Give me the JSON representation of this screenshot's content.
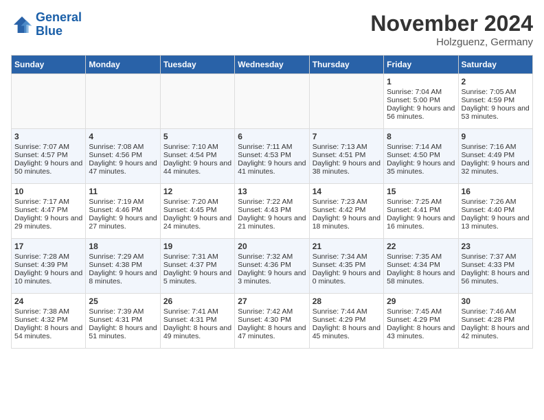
{
  "logo": {
    "line1": "General",
    "line2": "Blue"
  },
  "title": "November 2024",
  "location": "Holzguenz, Germany",
  "days_of_week": [
    "Sunday",
    "Monday",
    "Tuesday",
    "Wednesday",
    "Thursday",
    "Friday",
    "Saturday"
  ],
  "weeks": [
    [
      {
        "day": "",
        "content": ""
      },
      {
        "day": "",
        "content": ""
      },
      {
        "day": "",
        "content": ""
      },
      {
        "day": "",
        "content": ""
      },
      {
        "day": "",
        "content": ""
      },
      {
        "day": "1",
        "content": "Sunrise: 7:04 AM\nSunset: 5:00 PM\nDaylight: 9 hours and 56 minutes."
      },
      {
        "day": "2",
        "content": "Sunrise: 7:05 AM\nSunset: 4:59 PM\nDaylight: 9 hours and 53 minutes."
      }
    ],
    [
      {
        "day": "3",
        "content": "Sunrise: 7:07 AM\nSunset: 4:57 PM\nDaylight: 9 hours and 50 minutes."
      },
      {
        "day": "4",
        "content": "Sunrise: 7:08 AM\nSunset: 4:56 PM\nDaylight: 9 hours and 47 minutes."
      },
      {
        "day": "5",
        "content": "Sunrise: 7:10 AM\nSunset: 4:54 PM\nDaylight: 9 hours and 44 minutes."
      },
      {
        "day": "6",
        "content": "Sunrise: 7:11 AM\nSunset: 4:53 PM\nDaylight: 9 hours and 41 minutes."
      },
      {
        "day": "7",
        "content": "Sunrise: 7:13 AM\nSunset: 4:51 PM\nDaylight: 9 hours and 38 minutes."
      },
      {
        "day": "8",
        "content": "Sunrise: 7:14 AM\nSunset: 4:50 PM\nDaylight: 9 hours and 35 minutes."
      },
      {
        "day": "9",
        "content": "Sunrise: 7:16 AM\nSunset: 4:49 PM\nDaylight: 9 hours and 32 minutes."
      }
    ],
    [
      {
        "day": "10",
        "content": "Sunrise: 7:17 AM\nSunset: 4:47 PM\nDaylight: 9 hours and 29 minutes."
      },
      {
        "day": "11",
        "content": "Sunrise: 7:19 AM\nSunset: 4:46 PM\nDaylight: 9 hours and 27 minutes."
      },
      {
        "day": "12",
        "content": "Sunrise: 7:20 AM\nSunset: 4:45 PM\nDaylight: 9 hours and 24 minutes."
      },
      {
        "day": "13",
        "content": "Sunrise: 7:22 AM\nSunset: 4:43 PM\nDaylight: 9 hours and 21 minutes."
      },
      {
        "day": "14",
        "content": "Sunrise: 7:23 AM\nSunset: 4:42 PM\nDaylight: 9 hours and 18 minutes."
      },
      {
        "day": "15",
        "content": "Sunrise: 7:25 AM\nSunset: 4:41 PM\nDaylight: 9 hours and 16 minutes."
      },
      {
        "day": "16",
        "content": "Sunrise: 7:26 AM\nSunset: 4:40 PM\nDaylight: 9 hours and 13 minutes."
      }
    ],
    [
      {
        "day": "17",
        "content": "Sunrise: 7:28 AM\nSunset: 4:39 PM\nDaylight: 9 hours and 10 minutes."
      },
      {
        "day": "18",
        "content": "Sunrise: 7:29 AM\nSunset: 4:38 PM\nDaylight: 9 hours and 8 minutes."
      },
      {
        "day": "19",
        "content": "Sunrise: 7:31 AM\nSunset: 4:37 PM\nDaylight: 9 hours and 5 minutes."
      },
      {
        "day": "20",
        "content": "Sunrise: 7:32 AM\nSunset: 4:36 PM\nDaylight: 9 hours and 3 minutes."
      },
      {
        "day": "21",
        "content": "Sunrise: 7:34 AM\nSunset: 4:35 PM\nDaylight: 9 hours and 0 minutes."
      },
      {
        "day": "22",
        "content": "Sunrise: 7:35 AM\nSunset: 4:34 PM\nDaylight: 8 hours and 58 minutes."
      },
      {
        "day": "23",
        "content": "Sunrise: 7:37 AM\nSunset: 4:33 PM\nDaylight: 8 hours and 56 minutes."
      }
    ],
    [
      {
        "day": "24",
        "content": "Sunrise: 7:38 AM\nSunset: 4:32 PM\nDaylight: 8 hours and 54 minutes."
      },
      {
        "day": "25",
        "content": "Sunrise: 7:39 AM\nSunset: 4:31 PM\nDaylight: 8 hours and 51 minutes."
      },
      {
        "day": "26",
        "content": "Sunrise: 7:41 AM\nSunset: 4:31 PM\nDaylight: 8 hours and 49 minutes."
      },
      {
        "day": "27",
        "content": "Sunrise: 7:42 AM\nSunset: 4:30 PM\nDaylight: 8 hours and 47 minutes."
      },
      {
        "day": "28",
        "content": "Sunrise: 7:44 AM\nSunset: 4:29 PM\nDaylight: 8 hours and 45 minutes."
      },
      {
        "day": "29",
        "content": "Sunrise: 7:45 AM\nSunset: 4:29 PM\nDaylight: 8 hours and 43 minutes."
      },
      {
        "day": "30",
        "content": "Sunrise: 7:46 AM\nSunset: 4:28 PM\nDaylight: 8 hours and 42 minutes."
      }
    ]
  ]
}
